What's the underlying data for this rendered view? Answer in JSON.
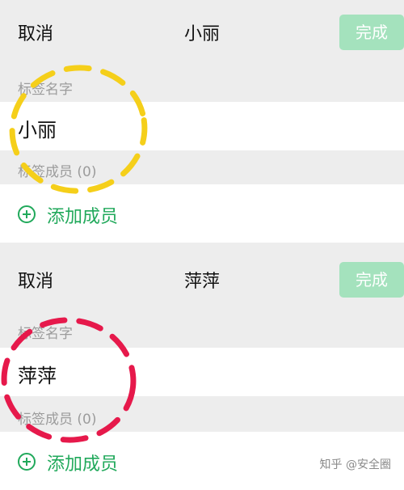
{
  "panels": [
    {
      "cancel_label": "取消",
      "title": "小丽",
      "done_label": "完成",
      "tag_name_label": "标签名字",
      "tag_name_value": "小丽",
      "members_label": "标签成员 (0)",
      "add_member_label": "添加成员"
    },
    {
      "cancel_label": "取消",
      "title": "萍萍",
      "done_label": "完成",
      "tag_name_label": "标签名字",
      "tag_name_value": "萍萍",
      "members_label": "标签成员 (0)",
      "add_member_label": "添加成员"
    }
  ],
  "annotations": {
    "circle_1_color": "#f5cf1a",
    "circle_2_color": "#e6194b"
  },
  "colors": {
    "accent": "#21a95b",
    "done_button_disabled": "#a4e2bd",
    "background": "#ededed"
  },
  "icons": [
    "plus-circle-icon"
  ],
  "watermark": "知乎 @安全圈"
}
